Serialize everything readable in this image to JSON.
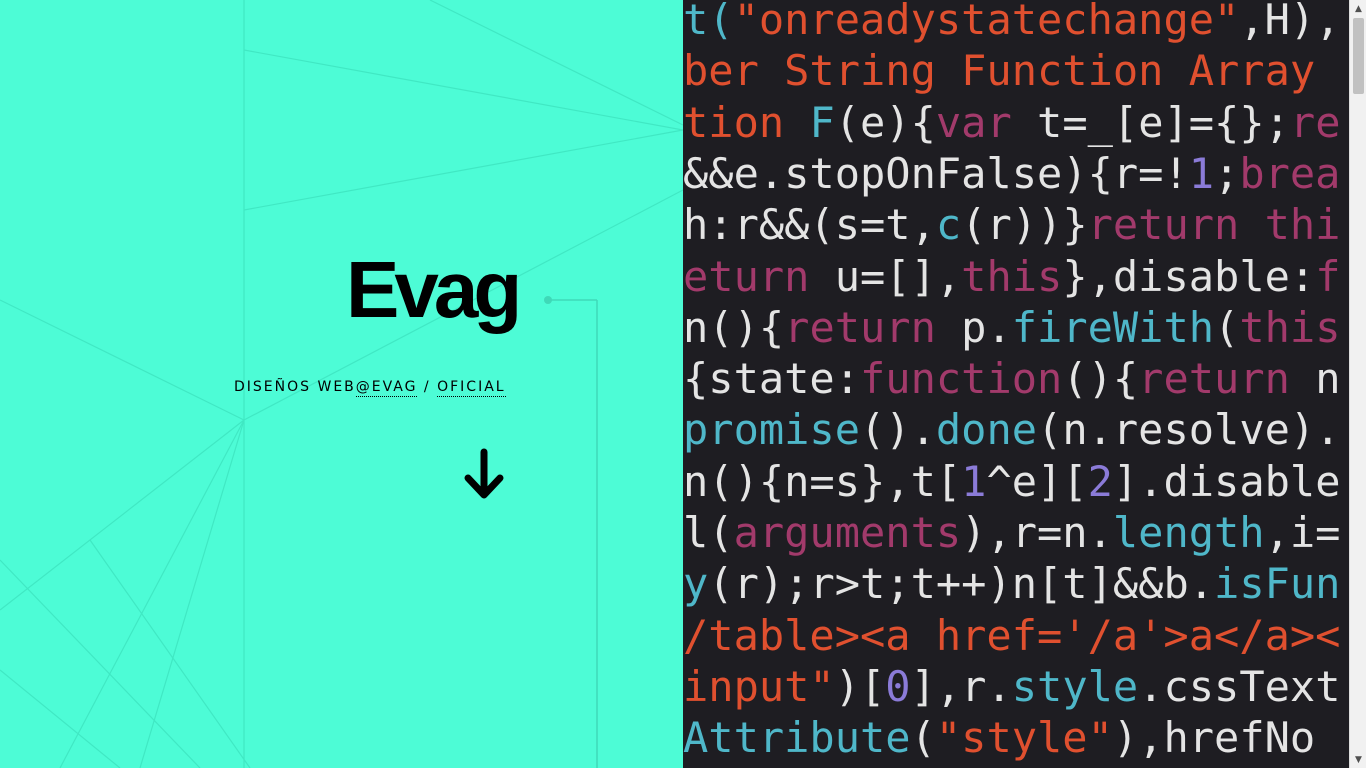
{
  "hero": {
    "title": "Evag",
    "subtitle_prefix": "DISEÑOS WEB",
    "subtitle_link": "@EVAG",
    "subtitle_sep": " / ",
    "subtitle_link2": "OFICIAL",
    "scroll_down_icon": "arrow-down-icon"
  },
  "code_background": {
    "lines": [
      [
        [
          "t(",
          "#4fb7c9"
        ],
        [
          "\"onreadystatechange\"",
          "#e0502f"
        ],
        [
          ",H),",
          "#e4e4e4"
        ]
      ],
      [
        [
          "ber String Function Array",
          "#e0502f"
        ]
      ],
      [
        [
          "tion ",
          "#e0502f"
        ],
        [
          "F",
          "#4fb7c9"
        ],
        [
          "(e){",
          "#e4e4e4"
        ],
        [
          "var ",
          "#a23a6b"
        ],
        [
          "t=_[e]={};",
          "#e4e4e4"
        ],
        [
          "re",
          "#a23a6b"
        ]
      ],
      [
        [
          "&&e.stopOnFalse){r=!",
          "#e4e4e4"
        ],
        [
          "1",
          "#8b7bd8"
        ],
        [
          ";",
          "#e4e4e4"
        ],
        [
          "brea",
          "#a23a6b"
        ]
      ],
      [
        [
          "h:r&&(s=t,",
          "#e4e4e4"
        ],
        [
          "c",
          "#4fb7c9"
        ],
        [
          "(r))}",
          "#e4e4e4"
        ],
        [
          "return thi",
          "#a23a6b"
        ]
      ],
      [
        [
          "eturn ",
          "#a23a6b"
        ],
        [
          "u=[],",
          "#e4e4e4"
        ],
        [
          "this",
          "#a23a6b"
        ],
        [
          "},disable:",
          "#e4e4e4"
        ],
        [
          "f",
          "#a23a6b"
        ]
      ],
      [
        [
          "n(){",
          "#e4e4e4"
        ],
        [
          "return ",
          "#a23a6b"
        ],
        [
          "p.",
          "#e4e4e4"
        ],
        [
          "fireWith",
          "#4fb7c9"
        ],
        [
          "(",
          "#e4e4e4"
        ],
        [
          "this",
          "#a23a6b"
        ]
      ],
      [
        [
          "{state:",
          "#e4e4e4"
        ],
        [
          "function",
          "#a23a6b"
        ],
        [
          "(){",
          "#e4e4e4"
        ],
        [
          "return ",
          "#a23a6b"
        ],
        [
          "n",
          "#e4e4e4"
        ]
      ],
      [
        [
          "promise",
          "#4fb7c9"
        ],
        [
          "().",
          "#e4e4e4"
        ],
        [
          "done",
          "#4fb7c9"
        ],
        [
          "(n.resolve).",
          "#e4e4e4"
        ]
      ],
      [
        [
          "n(){n=s},t[",
          "#e4e4e4"
        ],
        [
          "1",
          "#8b7bd8"
        ],
        [
          "^e][",
          "#e4e4e4"
        ],
        [
          "2",
          "#8b7bd8"
        ],
        [
          "].disable",
          "#e4e4e4"
        ]
      ],
      [
        [
          "l(",
          "#e4e4e4"
        ],
        [
          "arguments",
          "#a23a6b"
        ],
        [
          "),r=n.",
          "#e4e4e4"
        ],
        [
          "length",
          "#4fb7c9"
        ],
        [
          ",i=",
          "#e4e4e4"
        ]
      ],
      [
        [
          "y",
          "#4fb7c9"
        ],
        [
          "(r);r>t;t++)n[t]&&b.",
          "#e4e4e4"
        ],
        [
          "isFun",
          "#4fb7c9"
        ]
      ],
      [
        [
          "/table><a href='/a'>a</a><",
          "#e0502f"
        ]
      ],
      [
        [
          "input\"",
          "#e0502f"
        ],
        [
          ")[",
          "#e4e4e4"
        ],
        [
          "0",
          "#8b7bd8"
        ],
        [
          "],r.",
          "#e4e4e4"
        ],
        [
          "style",
          "#4fb7c9"
        ],
        [
          ".cssText",
          "#e4e4e4"
        ]
      ],
      [
        [
          "Attribute",
          "#4fb7c9"
        ],
        [
          "(",
          "#e4e4e4"
        ],
        [
          "\"style\"",
          "#e0502f"
        ],
        [
          "),hrefNo",
          "#e4e4e4"
        ]
      ]
    ]
  },
  "scrollbar": {
    "up_icon": "▲",
    "down_icon": "▼",
    "position": 0.0
  }
}
